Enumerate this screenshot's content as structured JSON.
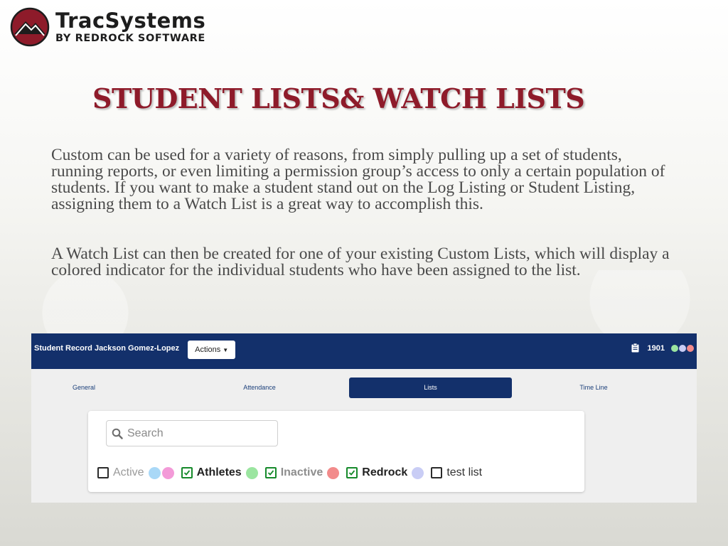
{
  "brand": {
    "name": "TracSystems",
    "tagline": "BY REDROCK SOFTWARE"
  },
  "slide": {
    "title": "STUDENT LISTS& WATCH LISTS",
    "paragraph1": "Custom can be used for a variety of reasons, from simply pulling up a set of students, running reports, or even limiting a permission group’s access to only a certain population of students. If you want to make a student stand out on the Log Listing or Student Listing, assigning them to a Watch List is a great way to accomplish this.",
    "paragraph2": "A Watch List can then be created for one of your existing Custom Lists, which will display a colored indicator for the individual students who have been assigned to the list."
  },
  "app": {
    "record_title": "Student Record Jackson Gomez-Lopez",
    "actions_label": "Actions",
    "record_id": "1901",
    "header_dots": [
      "#9be5a0",
      "#c9cdf5",
      "#f28b8b"
    ],
    "tabs": [
      {
        "label": "General",
        "active": false
      },
      {
        "label": "Attendance",
        "active": false
      },
      {
        "label": "Lists",
        "active": true
      },
      {
        "label": "Time Line",
        "active": false
      }
    ],
    "search": {
      "placeholder": "Search"
    },
    "lists": [
      {
        "label": "Active",
        "checked": false,
        "dots": [
          "#a9d8f7",
          "#f39ad8"
        ]
      },
      {
        "label": "Athletes",
        "checked": true,
        "dots": [
          "#9be5a0"
        ]
      },
      {
        "label": "Inactive",
        "checked": true,
        "dots": [
          "#f28b8b"
        ]
      },
      {
        "label": "Redrock",
        "checked": true,
        "dots": [
          "#c9cdf5"
        ]
      },
      {
        "label": "test list",
        "checked": false,
        "dots": []
      }
    ]
  },
  "colors": {
    "title": "#8e1b2a",
    "header": "#13306b",
    "check": "#168a2b"
  }
}
